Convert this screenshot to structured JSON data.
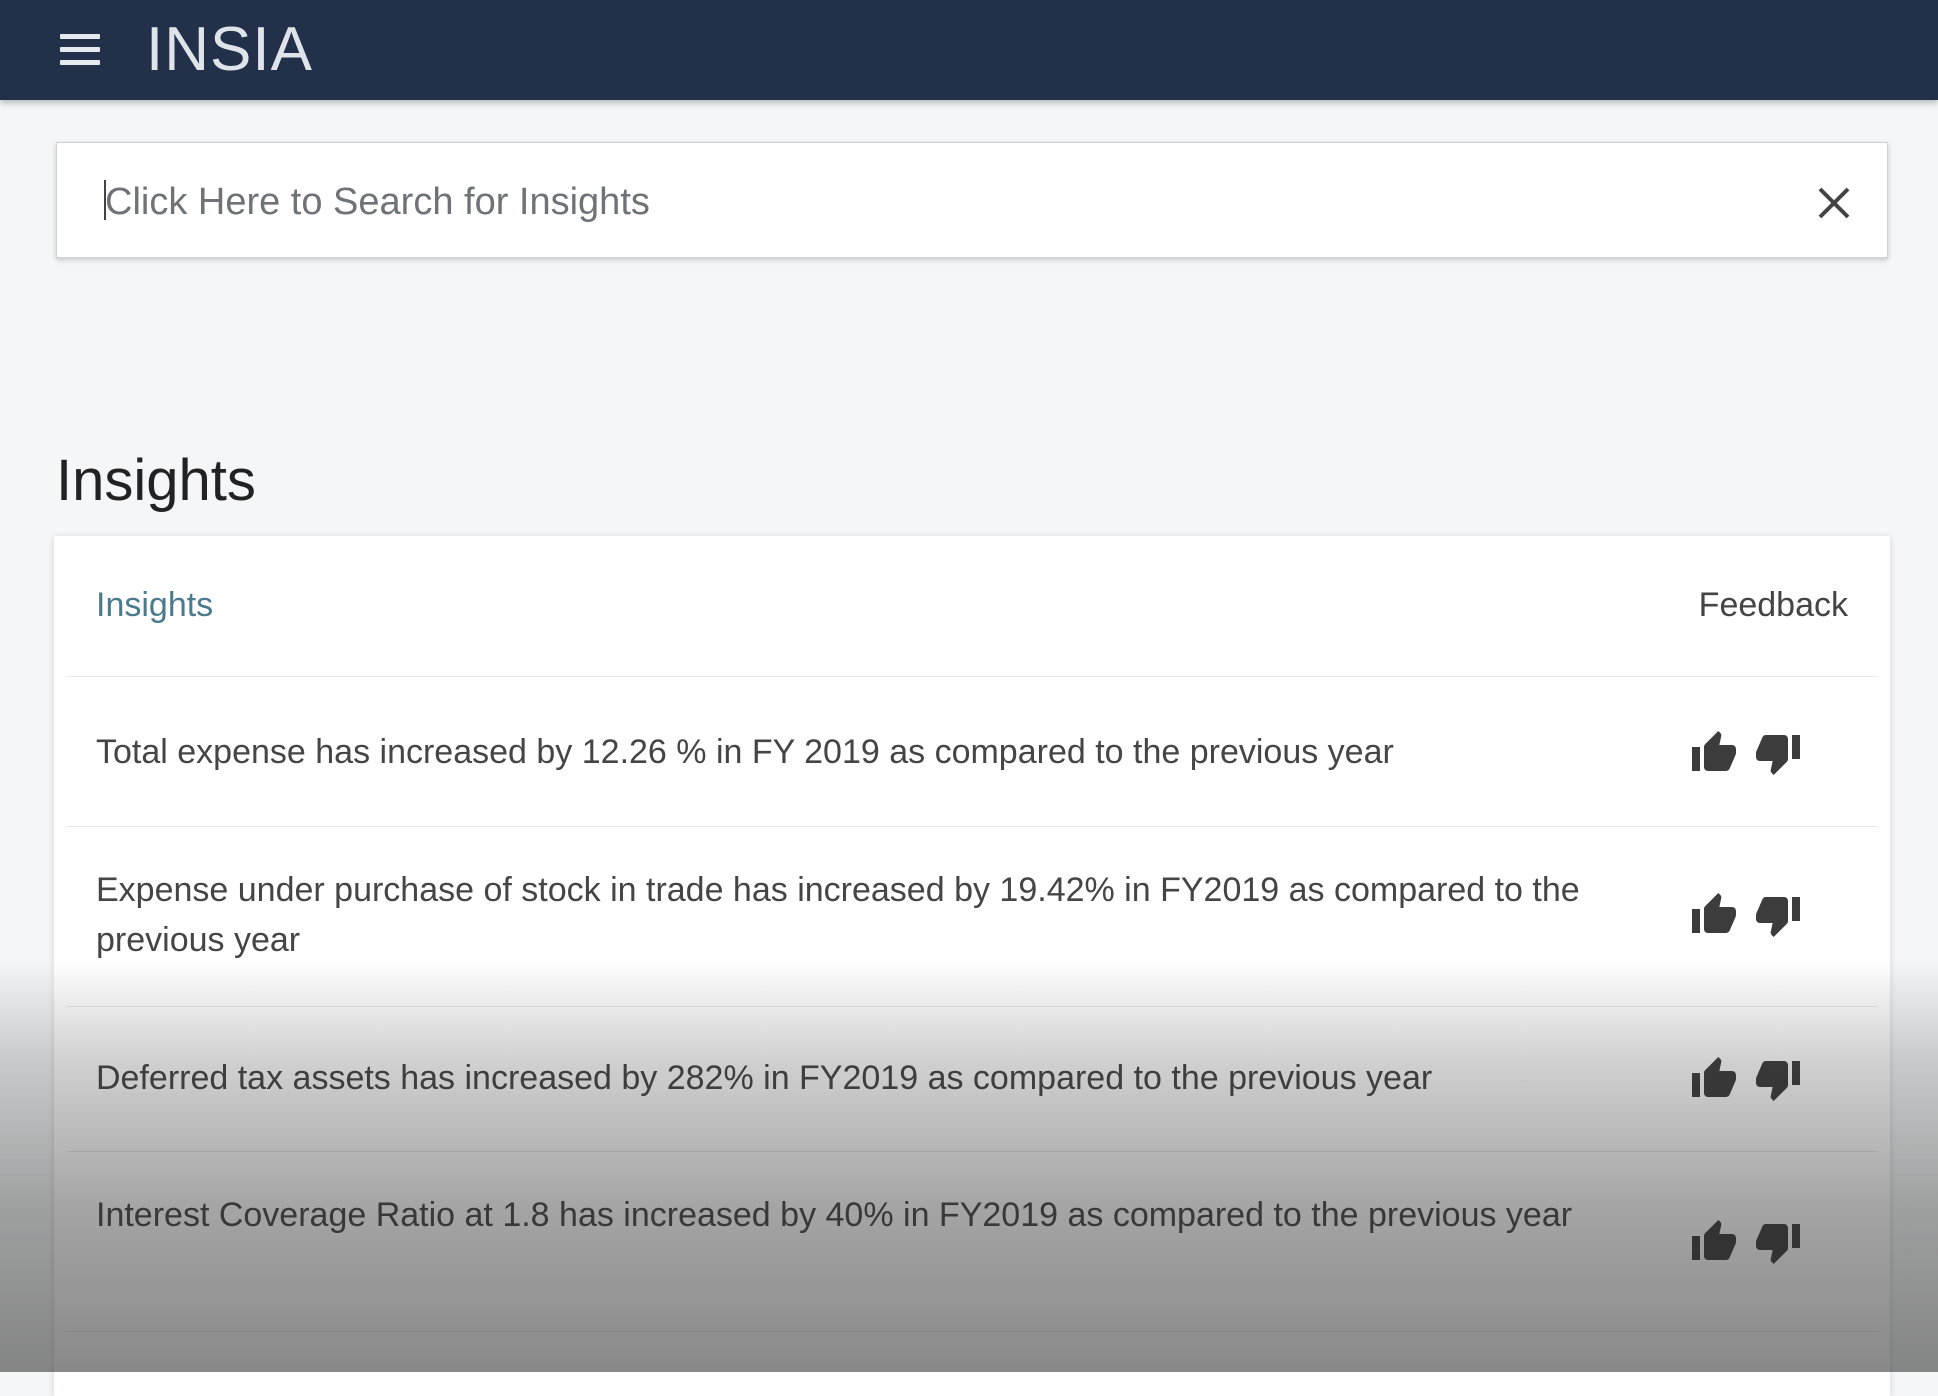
{
  "header": {
    "menu_icon": "hamburger-menu-icon",
    "logo_text": "INSIA"
  },
  "search": {
    "placeholder": "Click Here to Search for Insights",
    "value": "",
    "clear_icon": "close-icon"
  },
  "page": {
    "title": "Insights"
  },
  "table": {
    "col_insights": "Insights",
    "col_feedback": "Feedback",
    "rows": [
      {
        "text": "Total expense has increased by 12.26 % in FY 2019 as compared to the previous year"
      },
      {
        "text": "Expense under purchase of stock in trade has increased by 19.42% in FY2019 as compared to the previous year"
      },
      {
        "text": "Deferred tax assets has increased by 282% in FY2019 as compared to the previous year"
      },
      {
        "text": "Interest Coverage Ratio at 1.8 has increased by 40% in FY2019 as compared to the previous year"
      }
    ],
    "feedback_icons": [
      "thumbs-up-icon",
      "thumbs-down-icon"
    ]
  },
  "colors": {
    "topbar": "#233049",
    "accent_link": "#4a7a8c"
  }
}
